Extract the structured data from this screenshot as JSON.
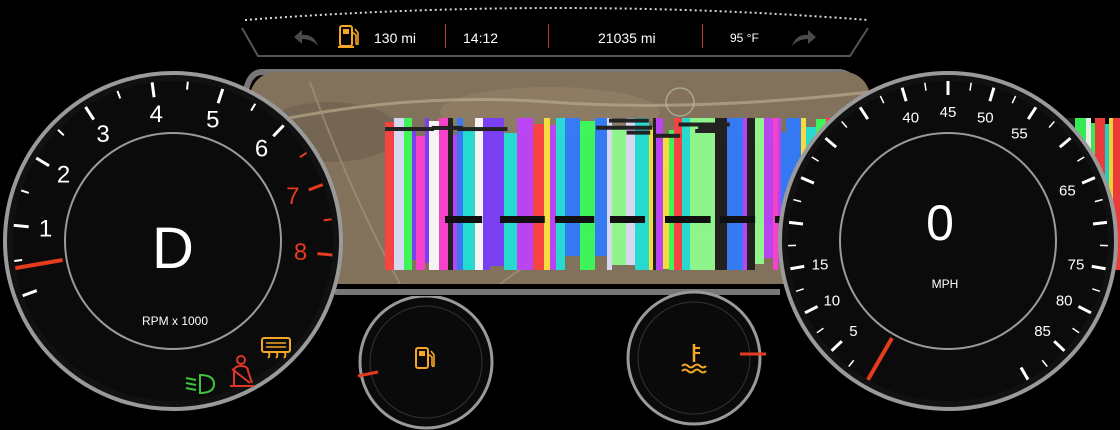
{
  "top_bar": {
    "back_icon": "arrow-back-icon",
    "fuel_icon": "fuel-pump-icon",
    "range": "130 mi",
    "time": "14:12",
    "odometer": "21035 mi",
    "outside_temp": "95 °F",
    "forward_icon": "arrow-forward-icon"
  },
  "tachometer": {
    "gear": "D",
    "unit_label": "RPM x 1000",
    "ticks": [
      "1",
      "2",
      "3",
      "4",
      "5",
      "6",
      "7",
      "8"
    ],
    "redline_ticks": [
      "7",
      "8"
    ],
    "needle_value_rpm_x1000": 0.4
  },
  "speedometer": {
    "speed": "0",
    "unit_label": "MPH",
    "ticks": [
      "5",
      "10",
      "15",
      "40",
      "45",
      "50",
      "55",
      "65",
      "75",
      "80",
      "85"
    ],
    "needle_value_mph": 0
  },
  "indicators": {
    "headlight_icon": "low-beam-headlight-icon",
    "seatbelt_icon": "seatbelt-warning-icon",
    "rear_defrost_icon": "rear-defrost-icon"
  },
  "mini_gauges": {
    "fuel_icon": "fuel-pump-icon",
    "coolant_icon": "coolant-temperature-icon"
  },
  "colors": {
    "accent_red": "#e53b1e",
    "warning_orange": "#f5a623",
    "indicator_green": "#3cc43c",
    "seatbelt_red": "#e0362a",
    "bezel_gray": "#9a9a9a"
  }
}
